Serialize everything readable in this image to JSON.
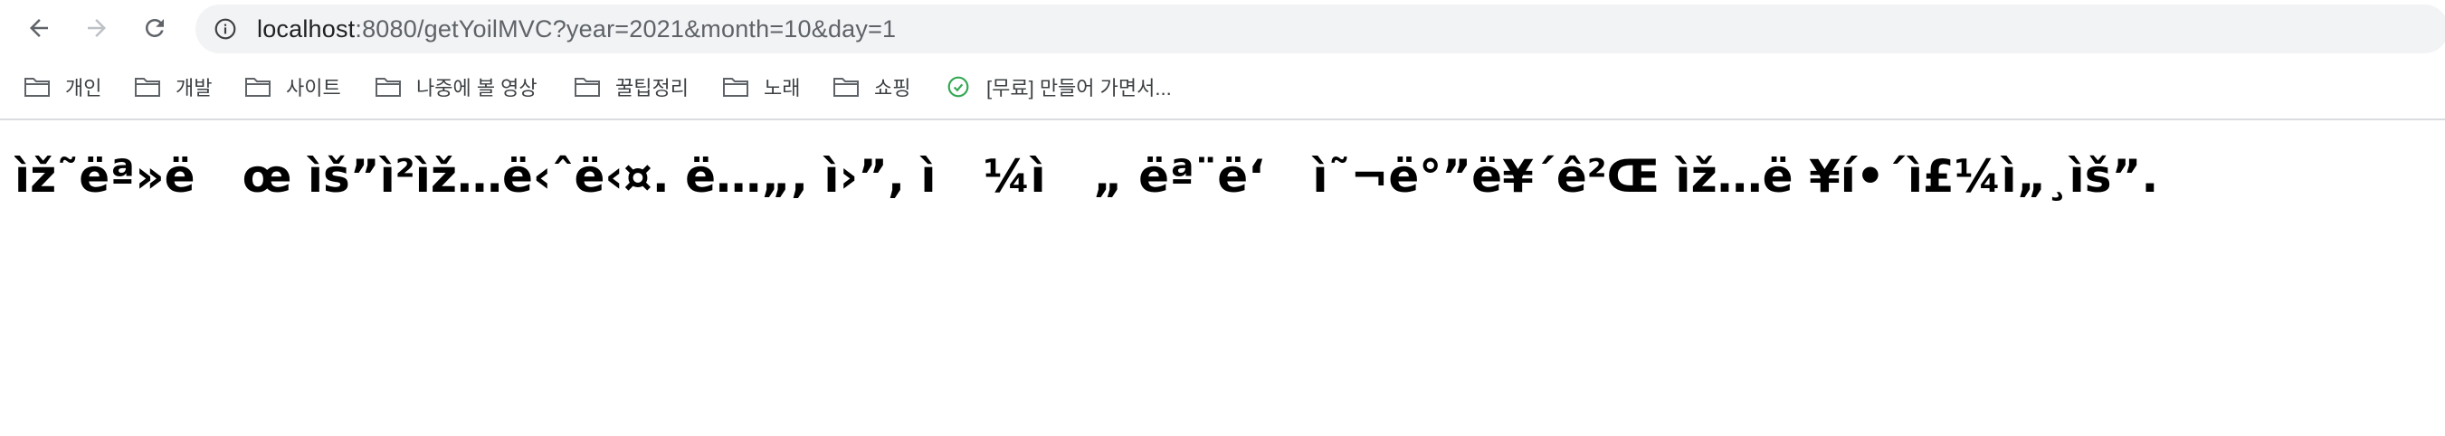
{
  "browser": {
    "url_host": "localhost",
    "url_path": ":8080/getYoilMVC?year=2021&month=10&day=1"
  },
  "bookmarks": [
    {
      "label": "개인",
      "icon": "folder-icon"
    },
    {
      "label": "개발",
      "icon": "folder-icon"
    },
    {
      "label": "사이트",
      "icon": "folder-icon"
    },
    {
      "label": "나중에 볼 영상",
      "icon": "folder-icon"
    },
    {
      "label": "꿀팁정리",
      "icon": "folder-icon"
    },
    {
      "label": "노래",
      "icon": "folder-icon"
    },
    {
      "label": "쇼핑",
      "icon": "folder-icon"
    },
    {
      "label": "[무료] 만들어 가면서...",
      "icon": "extension-icon"
    }
  ],
  "page": {
    "body_text": "ìž˜ëª»ë   œ ìš”ì²­ìž…ë‹ˆë‹¤. ë…„, ì›”, ì   ¼ì   „ ëª¨ë‘   ì˜¬ë°”ë¥´ê²Œ ìž…ë ¥í•´ì£¼ì„¸ìš”."
  },
  "colors": {
    "toolbar_bg": "#ffffff",
    "omnibox_bg": "#f1f3f4",
    "icon_gray": "#5f6368",
    "folder_gray": "#5f6368",
    "extension_green": "#34a853"
  }
}
